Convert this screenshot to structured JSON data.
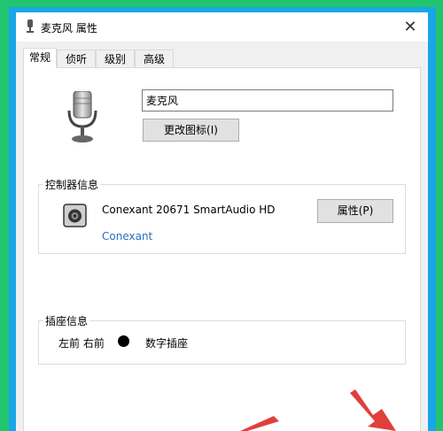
{
  "window": {
    "title": "麦克风 属性",
    "close_glyph": "✕"
  },
  "tabs": [
    {
      "label": "常规",
      "active": true
    },
    {
      "label": "侦听",
      "active": false
    },
    {
      "label": "级别",
      "active": false
    },
    {
      "label": "高级",
      "active": false
    }
  ],
  "general": {
    "device_name": "麦克风",
    "change_icon_label": "更改图标(I)"
  },
  "controller": {
    "group_title": "控制器信息",
    "name": "Conexant 20671 SmartAudio HD",
    "vendor_link": "Conexant",
    "properties_label": "属性(P)"
  },
  "jack": {
    "group_title": "插座信息",
    "position": "左前 右前",
    "type": "数字插座",
    "color": "#000000"
  },
  "colors": {
    "outer_border": "#21c46f",
    "inner_border": "#1aa6e6",
    "annotation_arrow": "#e0403a",
    "link": "#2a6ebd"
  }
}
